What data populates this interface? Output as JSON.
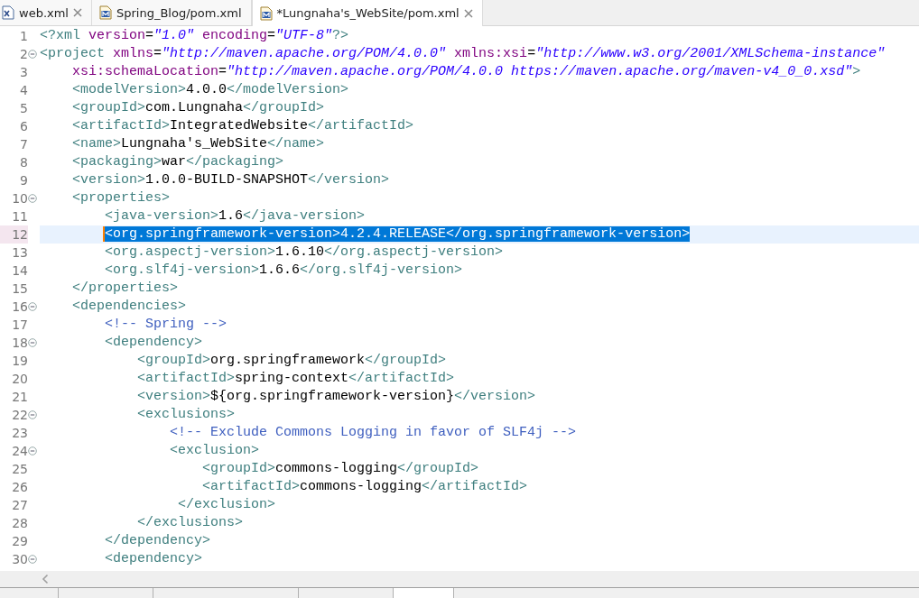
{
  "tabs": [
    {
      "label": "web.xml",
      "kind": "xml",
      "selected": false,
      "closable": true
    },
    {
      "label": "Spring_Blog/pom.xml",
      "kind": "maven",
      "selected": false,
      "closable": false
    },
    {
      "label": "*Lungnaha's_WebSite/pom.xml",
      "kind": "maven",
      "selected": true,
      "closable": true
    }
  ],
  "editor": {
    "lines": [
      {
        "number": "1",
        "foldable": false,
        "selected": false,
        "tokens": [
          {
            "kind": "tag",
            "text": "<?xml"
          },
          {
            "kind": "attr",
            "text": " version"
          },
          {
            "kind": "plain",
            "text": "="
          },
          {
            "kind": "string",
            "text": "\"1.0\""
          },
          {
            "kind": "attr",
            "text": " encoding"
          },
          {
            "kind": "plain",
            "text": "="
          },
          {
            "kind": "string",
            "text": "\"UTF-8\""
          },
          {
            "kind": "tag",
            "text": "?>"
          }
        ]
      },
      {
        "number": "2",
        "foldable": true,
        "selected": false,
        "tokens": [
          {
            "kind": "tag",
            "text": "<project"
          },
          {
            "kind": "attr",
            "text": " xmlns"
          },
          {
            "kind": "plain",
            "text": "="
          },
          {
            "kind": "string",
            "text": "\"http://maven.apache.org/POM/4.0.0\""
          },
          {
            "kind": "attr",
            "text": " xmlns:xsi"
          },
          {
            "kind": "plain",
            "text": "="
          },
          {
            "kind": "string",
            "text": "\"http://www.w3.org/2001/XMLSchema-instance\""
          }
        ]
      },
      {
        "number": "3",
        "foldable": false,
        "selected": false,
        "tokens": [
          {
            "kind": "attr",
            "text": "    xsi:schemaLocation"
          },
          {
            "kind": "plain",
            "text": "="
          },
          {
            "kind": "string",
            "text": "\"http://maven.apache.org/POM/4.0.0 https://maven.apache.org/maven-v4_0_0.xsd\""
          },
          {
            "kind": "tag",
            "text": ">"
          }
        ]
      },
      {
        "number": "4",
        "foldable": false,
        "selected": false,
        "tokens": [
          {
            "kind": "tag",
            "text": "    <modelVersion>"
          },
          {
            "kind": "plain",
            "text": "4.0.0"
          },
          {
            "kind": "tag",
            "text": "</modelVersion>"
          }
        ]
      },
      {
        "number": "5",
        "foldable": false,
        "selected": false,
        "tokens": [
          {
            "kind": "tag",
            "text": "    <groupId>"
          },
          {
            "kind": "plain",
            "text": "com.Lungnaha"
          },
          {
            "kind": "tag",
            "text": "</groupId>"
          }
        ]
      },
      {
        "number": "6",
        "foldable": false,
        "selected": false,
        "tokens": [
          {
            "kind": "tag",
            "text": "    <artifactId>"
          },
          {
            "kind": "plain",
            "text": "IntegratedWebsite"
          },
          {
            "kind": "tag",
            "text": "</artifactId>"
          }
        ]
      },
      {
        "number": "7",
        "foldable": false,
        "selected": false,
        "tokens": [
          {
            "kind": "tag",
            "text": "    <name>"
          },
          {
            "kind": "plain",
            "text": "Lungnaha's_WebSite"
          },
          {
            "kind": "tag",
            "text": "</name>"
          }
        ]
      },
      {
        "number": "8",
        "foldable": false,
        "selected": false,
        "tokens": [
          {
            "kind": "tag",
            "text": "    <packaging>"
          },
          {
            "kind": "plain",
            "text": "war"
          },
          {
            "kind": "tag",
            "text": "</packaging>"
          }
        ]
      },
      {
        "number": "9",
        "foldable": false,
        "selected": false,
        "tokens": [
          {
            "kind": "tag",
            "text": "    <version>"
          },
          {
            "kind": "plain",
            "text": "1.0.0-BUILD-SNAPSHOT"
          },
          {
            "kind": "tag",
            "text": "</version>"
          }
        ]
      },
      {
        "number": "10",
        "foldable": true,
        "selected": false,
        "tokens": [
          {
            "kind": "tag",
            "text": "    <properties>"
          }
        ]
      },
      {
        "number": "11",
        "foldable": false,
        "selected": false,
        "tokens": [
          {
            "kind": "tag",
            "text": "        <java-version>"
          },
          {
            "kind": "plain",
            "text": "1.6"
          },
          {
            "kind": "tag",
            "text": "</java-version>"
          }
        ]
      },
      {
        "number": "12",
        "foldable": false,
        "selected": true,
        "tokens": [
          {
            "kind": "tag",
            "text": "        <org.springframework-version>"
          },
          {
            "kind": "plain",
            "text": "4.2.4.RELEASE"
          },
          {
            "kind": "tag",
            "text": "</org.springframework-version>"
          }
        ]
      },
      {
        "number": "13",
        "foldable": false,
        "selected": false,
        "tokens": [
          {
            "kind": "tag",
            "text": "        <org.aspectj-version>"
          },
          {
            "kind": "plain",
            "text": "1.6.10"
          },
          {
            "kind": "tag",
            "text": "</org.aspectj-version>"
          }
        ]
      },
      {
        "number": "14",
        "foldable": false,
        "selected": false,
        "tokens": [
          {
            "kind": "tag",
            "text": "        <org.slf4j-version>"
          },
          {
            "kind": "plain",
            "text": "1.6.6"
          },
          {
            "kind": "tag",
            "text": "</org.slf4j-version>"
          }
        ]
      },
      {
        "number": "15",
        "foldable": false,
        "selected": false,
        "tokens": [
          {
            "kind": "tag",
            "text": "    </properties>"
          }
        ]
      },
      {
        "number": "16",
        "foldable": true,
        "selected": false,
        "tokens": [
          {
            "kind": "tag",
            "text": "    <dependencies>"
          }
        ]
      },
      {
        "number": "17",
        "foldable": false,
        "selected": false,
        "tokens": [
          {
            "kind": "comment",
            "text": "        <!-- Spring -->"
          }
        ]
      },
      {
        "number": "18",
        "foldable": true,
        "selected": false,
        "tokens": [
          {
            "kind": "tag",
            "text": "        <dependency>"
          }
        ]
      },
      {
        "number": "19",
        "foldable": false,
        "selected": false,
        "tokens": [
          {
            "kind": "tag",
            "text": "            <groupId>"
          },
          {
            "kind": "plain",
            "text": "org.springframework"
          },
          {
            "kind": "tag",
            "text": "</groupId>"
          }
        ]
      },
      {
        "number": "20",
        "foldable": false,
        "selected": false,
        "tokens": [
          {
            "kind": "tag",
            "text": "            <artifactId>"
          },
          {
            "kind": "plain",
            "text": "spring-context"
          },
          {
            "kind": "tag",
            "text": "</artifactId>"
          }
        ]
      },
      {
        "number": "21",
        "foldable": false,
        "selected": false,
        "tokens": [
          {
            "kind": "tag",
            "text": "            <version>"
          },
          {
            "kind": "plain",
            "text": "${org.springframework-version}"
          },
          {
            "kind": "tag",
            "text": "</version>"
          }
        ]
      },
      {
        "number": "22",
        "foldable": true,
        "selected": false,
        "tokens": [
          {
            "kind": "tag",
            "text": "            <exclusions>"
          }
        ]
      },
      {
        "number": "23",
        "foldable": false,
        "selected": false,
        "tokens": [
          {
            "kind": "comment",
            "text": "                <!-- Exclude Commons Logging in favor of SLF4j -->"
          }
        ]
      },
      {
        "number": "24",
        "foldable": true,
        "selected": false,
        "tokens": [
          {
            "kind": "tag",
            "text": "                <exclusion>"
          }
        ]
      },
      {
        "number": "25",
        "foldable": false,
        "selected": false,
        "tokens": [
          {
            "kind": "tag",
            "text": "                    <groupId>"
          },
          {
            "kind": "plain",
            "text": "commons-logging"
          },
          {
            "kind": "tag",
            "text": "</groupId>"
          }
        ]
      },
      {
        "number": "26",
        "foldable": false,
        "selected": false,
        "tokens": [
          {
            "kind": "tag",
            "text": "                    <artifactId>"
          },
          {
            "kind": "plain",
            "text": "commons-logging"
          },
          {
            "kind": "tag",
            "text": "</artifactId>"
          }
        ]
      },
      {
        "number": "27",
        "foldable": false,
        "selected": false,
        "tokens": [
          {
            "kind": "tag",
            "text": "                 </exclusion>"
          }
        ]
      },
      {
        "number": "28",
        "foldable": false,
        "selected": false,
        "tokens": [
          {
            "kind": "tag",
            "text": "            </exclusions>"
          }
        ]
      },
      {
        "number": "29",
        "foldable": false,
        "selected": false,
        "tokens": [
          {
            "kind": "tag",
            "text": "        </dependency>"
          }
        ]
      },
      {
        "number": "30",
        "foldable": true,
        "selected": false,
        "tokens": [
          {
            "kind": "tag",
            "text": "        <dependency>"
          }
        ]
      }
    ]
  },
  "bottom_tabs": [
    {
      "selected": false
    },
    {
      "selected": false
    },
    {
      "selected": false
    },
    {
      "selected": false
    },
    {
      "selected": true
    }
  ]
}
